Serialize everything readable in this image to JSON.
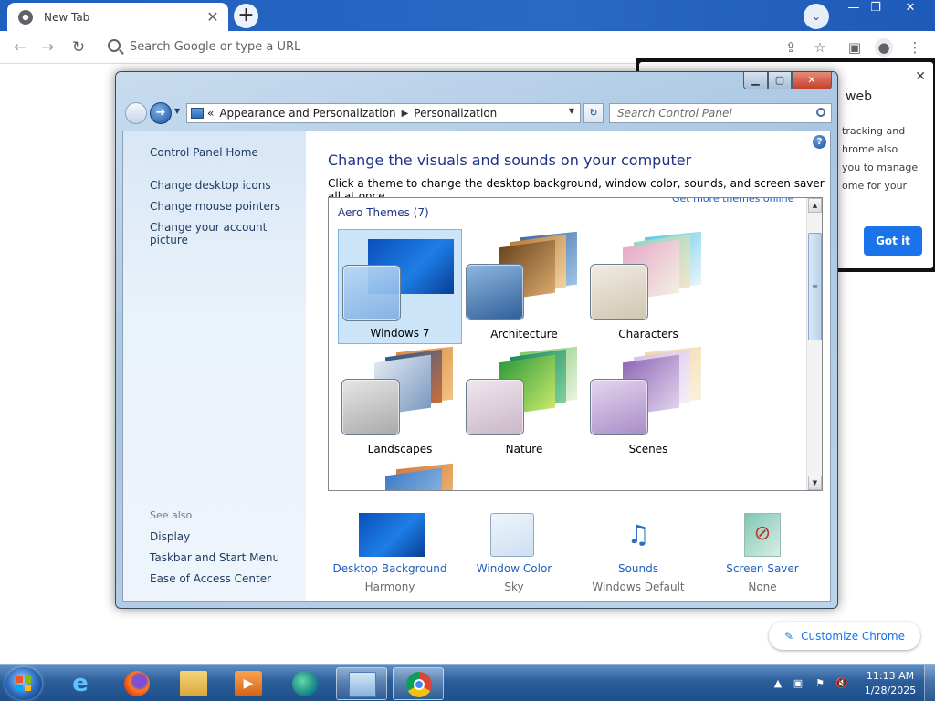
{
  "browser": {
    "tab_title": "New Tab",
    "omnibox_placeholder": "Search Google or type a URL",
    "customize_label": "Customize Chrome",
    "bubble": {
      "title": "web",
      "lines": [
        "tracking and",
        "hrome also",
        "you to manage",
        "ome for your"
      ],
      "got_it": "Got it"
    }
  },
  "control_panel": {
    "breadcrumb": [
      "Appearance and Personalization",
      "Personalization"
    ],
    "breadcrumb_prefix": "«",
    "search_placeholder": "Search Control Panel",
    "sidebar": {
      "home": "Control Panel Home",
      "links": [
        "Change desktop icons",
        "Change mouse pointers",
        "Change your account picture"
      ],
      "see_also_heading": "See also",
      "see_also": [
        "Display",
        "Taskbar and Start Menu",
        "Ease of Access Center"
      ]
    },
    "title": "Change the visuals and sounds on your computer",
    "subtitle": "Click a theme to change the desktop background, window color, sounds, and screen saver all at once.",
    "more_themes_link": "Get more themes online",
    "group_label": "Aero Themes (7)",
    "themes": [
      {
        "name": "Windows 7",
        "selected": true
      },
      {
        "name": "Architecture",
        "selected": false
      },
      {
        "name": "Characters",
        "selected": false
      },
      {
        "name": "Landscapes",
        "selected": false
      },
      {
        "name": "Nature",
        "selected": false
      },
      {
        "name": "Scenes",
        "selected": false
      }
    ],
    "bottom": [
      {
        "name": "Desktop Background",
        "value": "Harmony"
      },
      {
        "name": "Window Color",
        "value": "Sky"
      },
      {
        "name": "Sounds",
        "value": "Windows Default"
      },
      {
        "name": "Screen Saver",
        "value": "None"
      }
    ]
  },
  "taskbar": {
    "time": "11:13 AM",
    "date": "1/28/2025",
    "apps": [
      "internet-explorer-icon",
      "firefox-icon",
      "file-explorer-icon",
      "media-player-icon",
      "edge-icon",
      "control-panel-icon",
      "chrome-icon"
    ]
  },
  "colors": {
    "chrome_blue": "#1a73e8",
    "cp_heading": "#1e3287",
    "cp_link": "#1f5fbf",
    "taskbar": "#2a5e9b"
  }
}
